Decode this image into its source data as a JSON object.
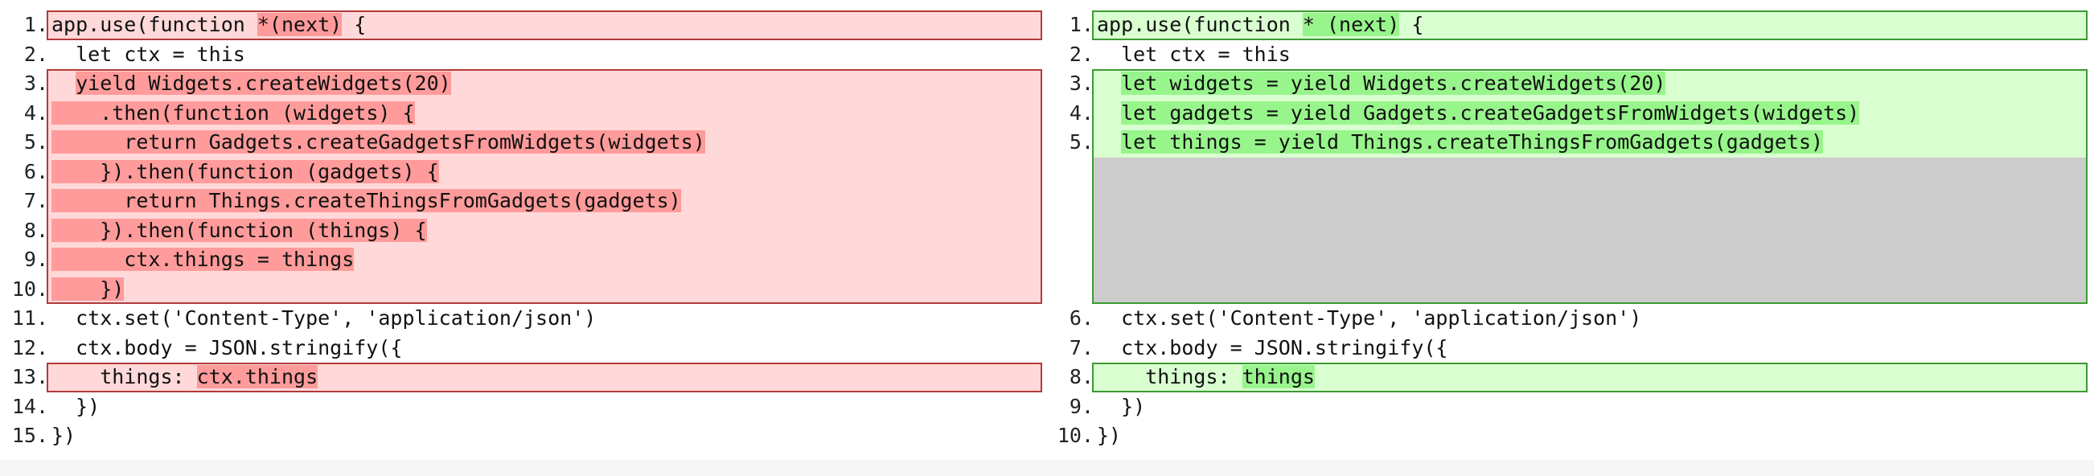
{
  "colors": {
    "deleted_bg": "#ffd9d9",
    "deleted_border": "#b23a3a",
    "deleted_highlight": "#ff9b9b",
    "inserted_bg": "#d9ffd1",
    "inserted_border": "#3c9a33",
    "inserted_highlight": "#98f58c",
    "placeholder_gray": "#cccccc"
  },
  "left": {
    "lines": [
      {
        "num": "1.",
        "kind": "del",
        "segments": [
          {
            "text": "app.use(function "
          },
          {
            "text": "*(next)",
            "hl": true
          },
          {
            "text": " {"
          }
        ]
      },
      {
        "num": "2.",
        "kind": "plain",
        "segments": [
          {
            "text": "  let ctx = this"
          }
        ]
      },
      {
        "num": "3.",
        "kind": "del",
        "segments": [
          {
            "text": "  "
          },
          {
            "text": "yield Widgets.createWidgets(20)",
            "hl": true
          }
        ]
      },
      {
        "num": "4.",
        "kind": "del",
        "segments": [
          {
            "text": "    .then(function (widgets) {",
            "hl": true
          }
        ]
      },
      {
        "num": "5.",
        "kind": "del",
        "segments": [
          {
            "text": "      return Gadgets.createGadgetsFromWidgets(widgets)",
            "hl": true
          }
        ]
      },
      {
        "num": "6.",
        "kind": "del",
        "segments": [
          {
            "text": "    }).then(function (gadgets) {",
            "hl": true
          }
        ]
      },
      {
        "num": "7.",
        "kind": "del",
        "segments": [
          {
            "text": "      return Things.createThingsFromGadgets(gadgets)",
            "hl": true
          }
        ]
      },
      {
        "num": "8.",
        "kind": "del",
        "segments": [
          {
            "text": "    }).then(function (things) {",
            "hl": true
          }
        ]
      },
      {
        "num": "9.",
        "kind": "del",
        "segments": [
          {
            "text": "      ctx.things = things",
            "hl": true
          }
        ]
      },
      {
        "num": "10.",
        "kind": "del",
        "segments": [
          {
            "text": "    })",
            "hl": true
          }
        ]
      },
      {
        "num": "11.",
        "kind": "plain",
        "segments": [
          {
            "text": "  ctx.set('Content-Type', 'application/json')"
          }
        ]
      },
      {
        "num": "12.",
        "kind": "plain",
        "segments": [
          {
            "text": "  ctx.body = JSON.stringify({"
          }
        ]
      },
      {
        "num": "13.",
        "kind": "del",
        "segments": [
          {
            "text": "    things: "
          },
          {
            "text": "ctx.things",
            "hl": true
          }
        ]
      },
      {
        "num": "14.",
        "kind": "plain",
        "segments": [
          {
            "text": "  })"
          }
        ]
      },
      {
        "num": "15.",
        "kind": "plain",
        "segments": [
          {
            "text": "})"
          }
        ]
      }
    ]
  },
  "right": {
    "lines": [
      {
        "num": "1.",
        "kind": "ins",
        "segments": [
          {
            "text": "app.use(function "
          },
          {
            "text": "* (next)",
            "hl": true
          },
          {
            "text": " {"
          }
        ]
      },
      {
        "num": "2.",
        "kind": "plain",
        "segments": [
          {
            "text": "  let ctx = this"
          }
        ]
      },
      {
        "num": "3.",
        "kind": "ins",
        "segments": [
          {
            "text": "  "
          },
          {
            "text": "let widgets = yield Widgets.createWidgets(20)",
            "hl": true
          }
        ]
      },
      {
        "num": "4.",
        "kind": "ins",
        "segments": [
          {
            "text": "  "
          },
          {
            "text": "let gadgets = yield Gadgets.createGadgetsFromWidgets(widgets)",
            "hl": true
          }
        ]
      },
      {
        "num": "5.",
        "kind": "ins",
        "segments": [
          {
            "text": "  "
          },
          {
            "text": "let things = yield Things.createThingsFromGadgets(gadgets)",
            "hl": true
          }
        ]
      },
      {
        "num": "",
        "kind": "gap",
        "segments": []
      },
      {
        "num": "",
        "kind": "gap",
        "segments": []
      },
      {
        "num": "",
        "kind": "gap",
        "segments": []
      },
      {
        "num": "",
        "kind": "gap",
        "segments": []
      },
      {
        "num": "",
        "kind": "gap",
        "segments": []
      },
      {
        "num": "6.",
        "kind": "plain",
        "segments": [
          {
            "text": "  ctx.set('Content-Type', 'application/json')"
          }
        ]
      },
      {
        "num": "7.",
        "kind": "plain",
        "segments": [
          {
            "text": "  ctx.body = JSON.stringify({"
          }
        ]
      },
      {
        "num": "8.",
        "kind": "ins",
        "segments": [
          {
            "text": "    things: "
          },
          {
            "text": "things",
            "hl": true
          }
        ]
      },
      {
        "num": "9.",
        "kind": "plain",
        "segments": [
          {
            "text": "  })"
          }
        ]
      },
      {
        "num": "10.",
        "kind": "plain",
        "segments": [
          {
            "text": "})"
          }
        ]
      }
    ]
  }
}
